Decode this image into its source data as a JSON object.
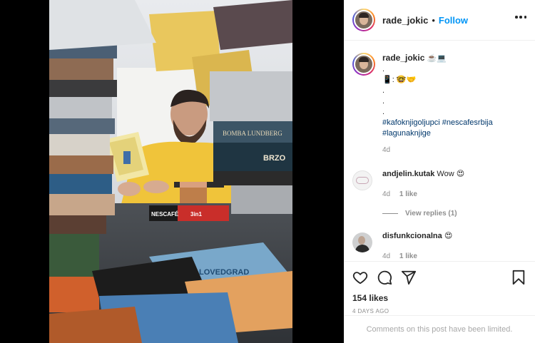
{
  "post": {
    "username": "rade_jokic",
    "follow_label": "Follow",
    "separator": "•"
  },
  "caption": {
    "username": "rade_jokic",
    "title_emoji": "☕️💻",
    "lines": [
      ".",
      "📱: 🤓🤝",
      ".",
      ".",
      "."
    ],
    "hashtags_line1": "#kafoknjigoljupci #nescafesrbija",
    "hashtags_line2": "#lagunaknjige",
    "age": "4d"
  },
  "comments": [
    {
      "username": "andjelin.kutak",
      "text": "Wow 😍",
      "age": "4d",
      "likes": "1 like"
    },
    {
      "username": "disfunkcionalna",
      "text": "😍",
      "age": "4d",
      "likes": "1 like"
    }
  ],
  "view_replies_label": "View replies (1)",
  "likes_count": "154 likes",
  "timestamp": "4 DAYS AGO",
  "comments_limited": "Comments on this post have been limited.",
  "icons": [
    "heart-icon",
    "comment-icon",
    "share-icon",
    "bookmark-icon",
    "more-options-icon"
  ],
  "photo": {
    "book_title": "BOMBA LUNDBERG",
    "book_cover_text": "BRZO",
    "packet_brand": "NESCAFÉ",
    "packet_label": "3in1",
    "table_book": "LOVEDGRAD"
  },
  "colors": {
    "follow": "#0095f6",
    "hashtag": "#00376b",
    "muted": "#8e8e8e"
  }
}
